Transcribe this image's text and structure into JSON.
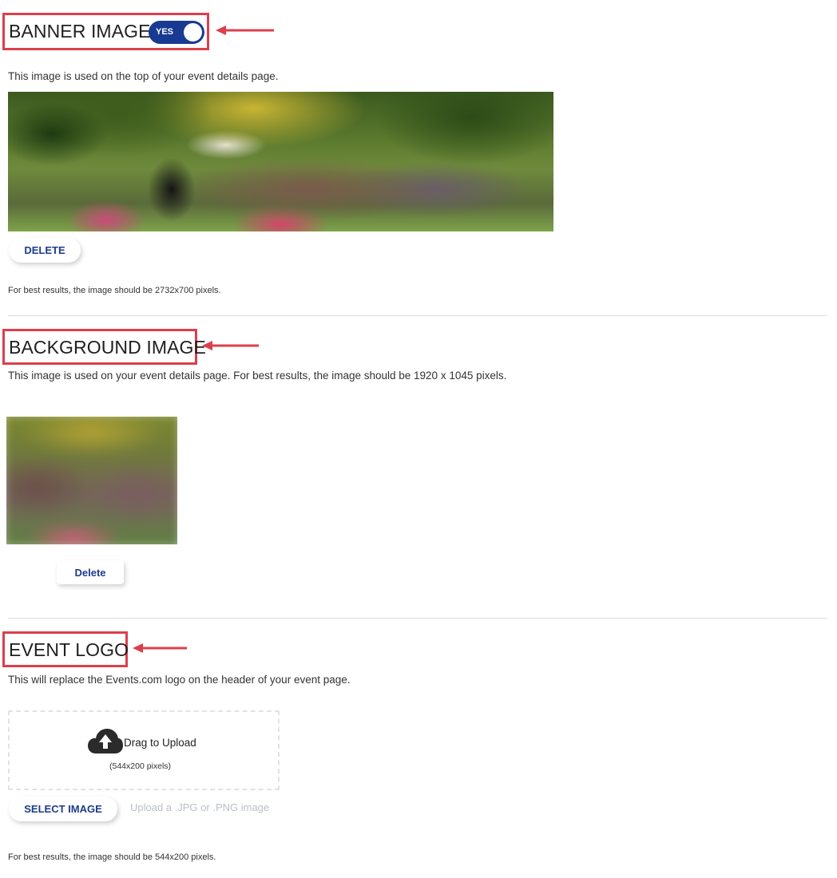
{
  "banner": {
    "title": "BANNER IMAGE",
    "toggle_label": "YES",
    "description": "This image is used on the top of your event details page.",
    "delete_label": "DELETE",
    "hint": "For best results, the image should be 2732x700 pixels."
  },
  "background": {
    "title": "BACKGROUND IMAGE",
    "description": "This image is used on your event details page. For best results, the image should be 1920 x 1045 pixels.",
    "delete_label": "Delete"
  },
  "logo": {
    "title": "EVENT LOGO",
    "description": "This will replace the Events.com logo on the header of your event page.",
    "upload_label": "Drag to Upload",
    "upload_size": "(544x200 pixels)",
    "select_label": "SELECT IMAGE",
    "upload_hint": "Upload a .JPG or .PNG image",
    "hint": "For best results, the image should be 544x200 pixels."
  },
  "icons": {
    "arrow": "left-arrow-icon",
    "upload": "cloud-upload-icon"
  },
  "colors": {
    "highlight": "#dc3f4c",
    "accent": "#183a92",
    "button_text": "#1e3b8a"
  }
}
